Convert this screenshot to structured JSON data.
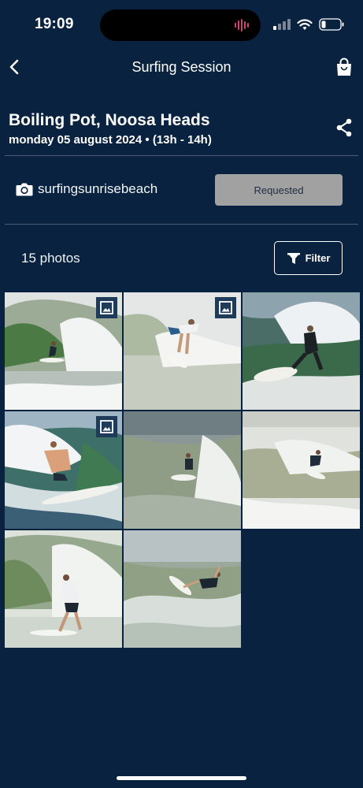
{
  "status_bar": {
    "time": "19:09"
  },
  "nav": {
    "title": "Surfing Session",
    "back_icon": "chevron-left-icon",
    "bag_icon": "shopping-bag-icon"
  },
  "session": {
    "title": "Boiling Pot, Noosa Heads",
    "date": "monday 05 august 2024 • (13h - 14h)",
    "share_icon": "share-icon"
  },
  "photographer": {
    "name": "surfingsunrisebeach",
    "icon": "camera-icon",
    "action_label": "Requested"
  },
  "gallery": {
    "count_label": "15 photos",
    "filter_label": "Filter",
    "filter_icon": "funnel-icon",
    "photos": [
      {
        "label": "surf-photo-1",
        "badge": true
      },
      {
        "label": "surf-photo-2",
        "badge": true
      },
      {
        "label": "surf-photo-3",
        "badge": false
      },
      {
        "label": "surf-photo-4",
        "badge": true
      },
      {
        "label": "surf-photo-5",
        "badge": false
      },
      {
        "label": "surf-photo-6",
        "badge": false
      },
      {
        "label": "surf-photo-7",
        "badge": false
      },
      {
        "label": "surf-photo-8",
        "badge": false
      }
    ]
  },
  "colors": {
    "background": "#08223f",
    "requested_button": "#a1a1a1",
    "badge": "#1e3b5a"
  }
}
